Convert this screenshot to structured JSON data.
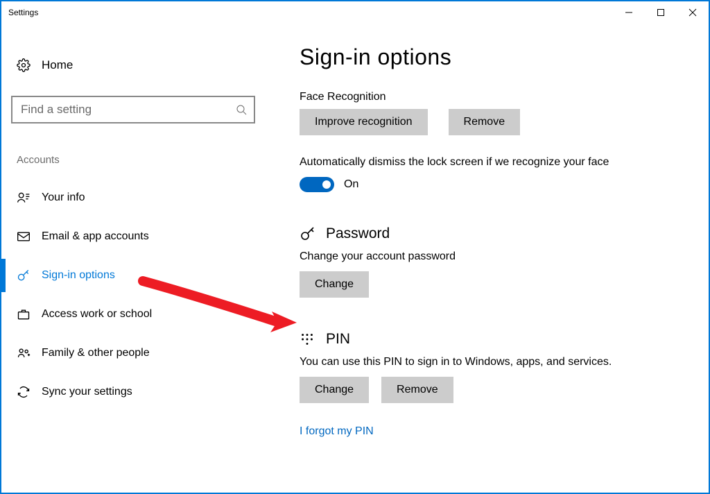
{
  "window": {
    "title": "Settings"
  },
  "sidebar": {
    "home_label": "Home",
    "search_placeholder": "Find a setting",
    "section_label": "Accounts",
    "items": [
      {
        "label": "Your info"
      },
      {
        "label": "Email & app accounts"
      },
      {
        "label": "Sign-in options"
      },
      {
        "label": "Access work or school"
      },
      {
        "label": "Family & other people"
      },
      {
        "label": "Sync your settings"
      }
    ]
  },
  "content": {
    "page_title": "Sign-in options",
    "face": {
      "label": "Face Recognition",
      "improve_btn": "Improve recognition",
      "remove_btn": "Remove",
      "auto_dismiss_text": "Automatically dismiss the lock screen if we recognize your face",
      "toggle_label": "On"
    },
    "password": {
      "heading": "Password",
      "desc": "Change your account password",
      "change_btn": "Change"
    },
    "pin": {
      "heading": "PIN",
      "desc": "You can use this PIN to sign in to Windows, apps, and services.",
      "change_btn": "Change",
      "remove_btn": "Remove",
      "forgot_link": "I forgot my PIN"
    }
  },
  "colors": {
    "accent": "#0078d7",
    "arrow": "#ed1c24"
  }
}
